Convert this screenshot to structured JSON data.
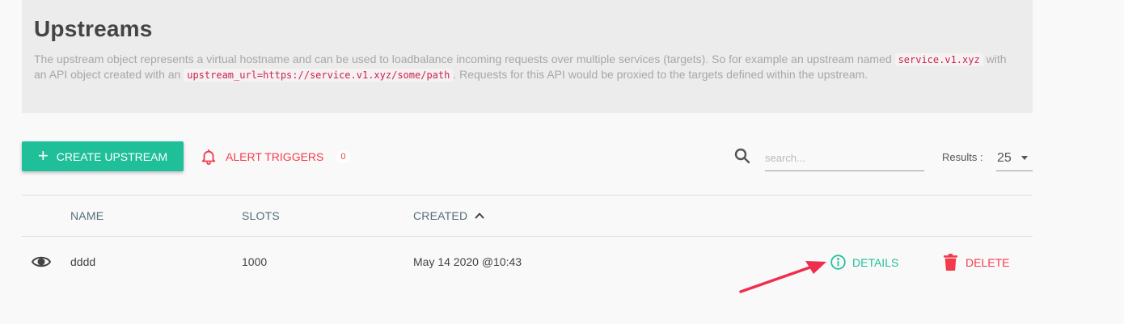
{
  "header": {
    "title": "Upstreams",
    "desc_part1": "The upstream object represents a virtual hostname and can be used to loadbalance incoming requests over multiple services (targets). So for example an upstream named",
    "code1": "service.v1.xyz",
    "desc_part2": "with an API object created with an",
    "code2": "upstream_url=https://service.v1.xyz/some/path",
    "desc_part3": ". Requests for this API would be proxied to the targets defined within the upstream."
  },
  "toolbar": {
    "create_label": "CREATE UPSTREAM",
    "alert_label": "ALERT TRIGGERS",
    "alert_count": "0",
    "search_placeholder": "search...",
    "results_label": "Results :",
    "results_value": "25"
  },
  "table": {
    "columns": [
      "NAME",
      "SLOTS",
      "CREATED"
    ],
    "sort_column": "CREATED",
    "sort_direction": "ascending",
    "rows": [
      {
        "name": "dddd",
        "slots": "1000",
        "created": "May 14 2020 @10:43",
        "details_label": "DETAILS",
        "delete_label": "DELETE"
      }
    ]
  },
  "colors": {
    "accent": "#1fbf9a",
    "danger": "#f23c4e",
    "header_bg": "#ececec",
    "code_text": "#c7254e"
  },
  "icons": [
    "plus-icon",
    "bell-icon",
    "search-icon",
    "chevron-down-icon",
    "chevron-up-icon",
    "eye-icon",
    "info-icon",
    "trash-icon",
    "annotation-arrow"
  ]
}
